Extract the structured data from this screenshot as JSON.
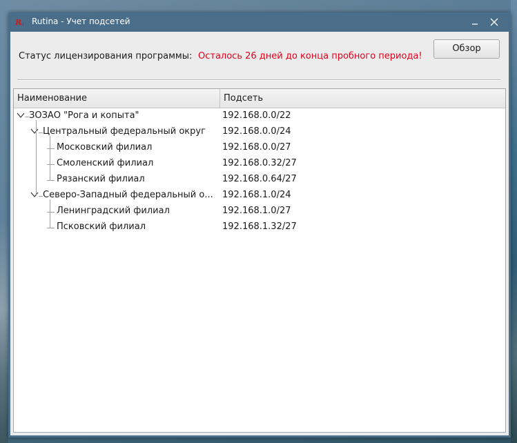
{
  "window": {
    "title": "Rutina - Учет подсетей",
    "icon": "rutina-app-icon",
    "controls": [
      "minimize-icon",
      "close-icon"
    ]
  },
  "license": {
    "label": "Статус лицензирования программы:",
    "status": "Осталось 26 дней до конца пробного периода!",
    "status_color": "#e5001c",
    "browse_label": "Обзор"
  },
  "table": {
    "columns": [
      "Наименование",
      "Подсеть"
    ],
    "rows": [
      {
        "name": "ЗОЗАО \"Рога и копыта\"",
        "subnet": "192.168.0.0/22",
        "level": 0,
        "expanded": true
      },
      {
        "name": "Центральный федеральный округ",
        "subnet": "192.168.0.0/24",
        "level": 1,
        "expanded": true
      },
      {
        "name": "Московский филиал",
        "subnet": "192.168.0.0/27",
        "level": 2
      },
      {
        "name": "Смоленский филиал",
        "subnet": "192.168.0.32/27",
        "level": 2
      },
      {
        "name": "Рязанский филиал",
        "subnet": "192.168.0.64/27",
        "level": 2
      },
      {
        "name": "Северо-Западный федеральный о...",
        "subnet": "192.168.1.0/24",
        "level": 1,
        "expanded": true
      },
      {
        "name": "Ленинградский филиал",
        "subnet": "192.168.1.0/27",
        "level": 2
      },
      {
        "name": "Псковский филиал",
        "subnet": "192.168.1.32/27",
        "level": 2
      }
    ]
  }
}
